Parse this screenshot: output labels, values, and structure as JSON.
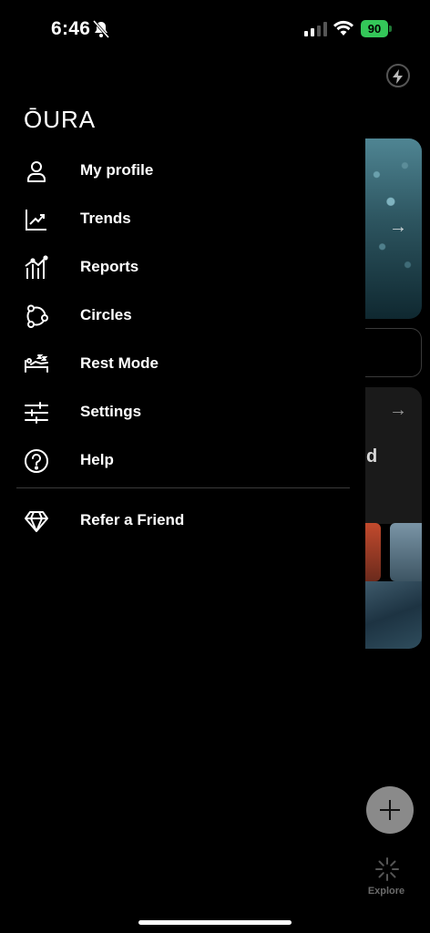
{
  "status_bar": {
    "time": "6:46",
    "battery": "90"
  },
  "drawer": {
    "logo": "ŌURA",
    "items": [
      {
        "label": "My profile",
        "icon": "person-icon"
      },
      {
        "label": "Trends",
        "icon": "trend-chart-icon"
      },
      {
        "label": "Reports",
        "icon": "reports-chart-icon"
      },
      {
        "label": "Circles",
        "icon": "circles-icon"
      },
      {
        "label": "Rest Mode",
        "icon": "rest-mode-icon"
      },
      {
        "label": "Settings",
        "icon": "sliders-icon"
      },
      {
        "label": "Help",
        "icon": "help-icon"
      }
    ],
    "refer": {
      "label": "Refer a Friend",
      "icon": "diamond-icon"
    }
  },
  "background": {
    "partial_text": "d",
    "explore_label": "Explore"
  },
  "colors": {
    "battery": "#34c759",
    "background": "#000000"
  }
}
